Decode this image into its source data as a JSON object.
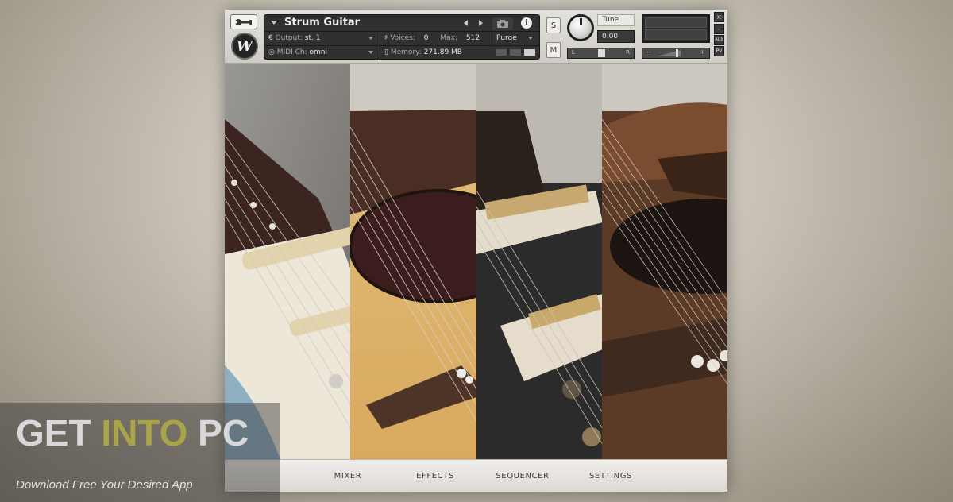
{
  "instrument": {
    "name": "Strum Guitar",
    "output_label": "Output:",
    "output_value": "st. 1",
    "voices_label": "Voices:",
    "voices_value": "0",
    "max_label": "Max:",
    "max_value": "512",
    "purge_label": "Purge",
    "midi_label": "MIDI Ch:",
    "midi_value": "omni",
    "memory_label": "Memory:",
    "memory_value": "271.89 MB",
    "info_icon_glyph": "i",
    "logo_letter": "W"
  },
  "controls": {
    "solo_label": "S",
    "mute_label": "M",
    "tune_label": "Tune",
    "tune_value": "0.00",
    "pan_left": "L",
    "pan_right": "R",
    "vol_minus": "−",
    "vol_plus": "+",
    "close_glyph": "×",
    "min_glyph": "–",
    "aux_label": "AUX",
    "pv_label": "PV"
  },
  "tabs": [
    {
      "label": "MIXER"
    },
    {
      "label": "EFFECTS"
    },
    {
      "label": "SEQUENCER"
    },
    {
      "label": "SETTINGS"
    }
  ],
  "icons": [
    "wrench-icon",
    "camera-icon",
    "info-icon",
    "dropdown-arrow-icon",
    "prev-arrow-icon",
    "next-arrow-icon"
  ],
  "watermark": {
    "title_part1": "GET ",
    "title_part2": "INTO",
    "title_part3": " PC",
    "subtitle": "Download Free Your Desired App"
  },
  "colors": {
    "panel_dark": "#303030",
    "accent_olive": "#a9a445"
  }
}
